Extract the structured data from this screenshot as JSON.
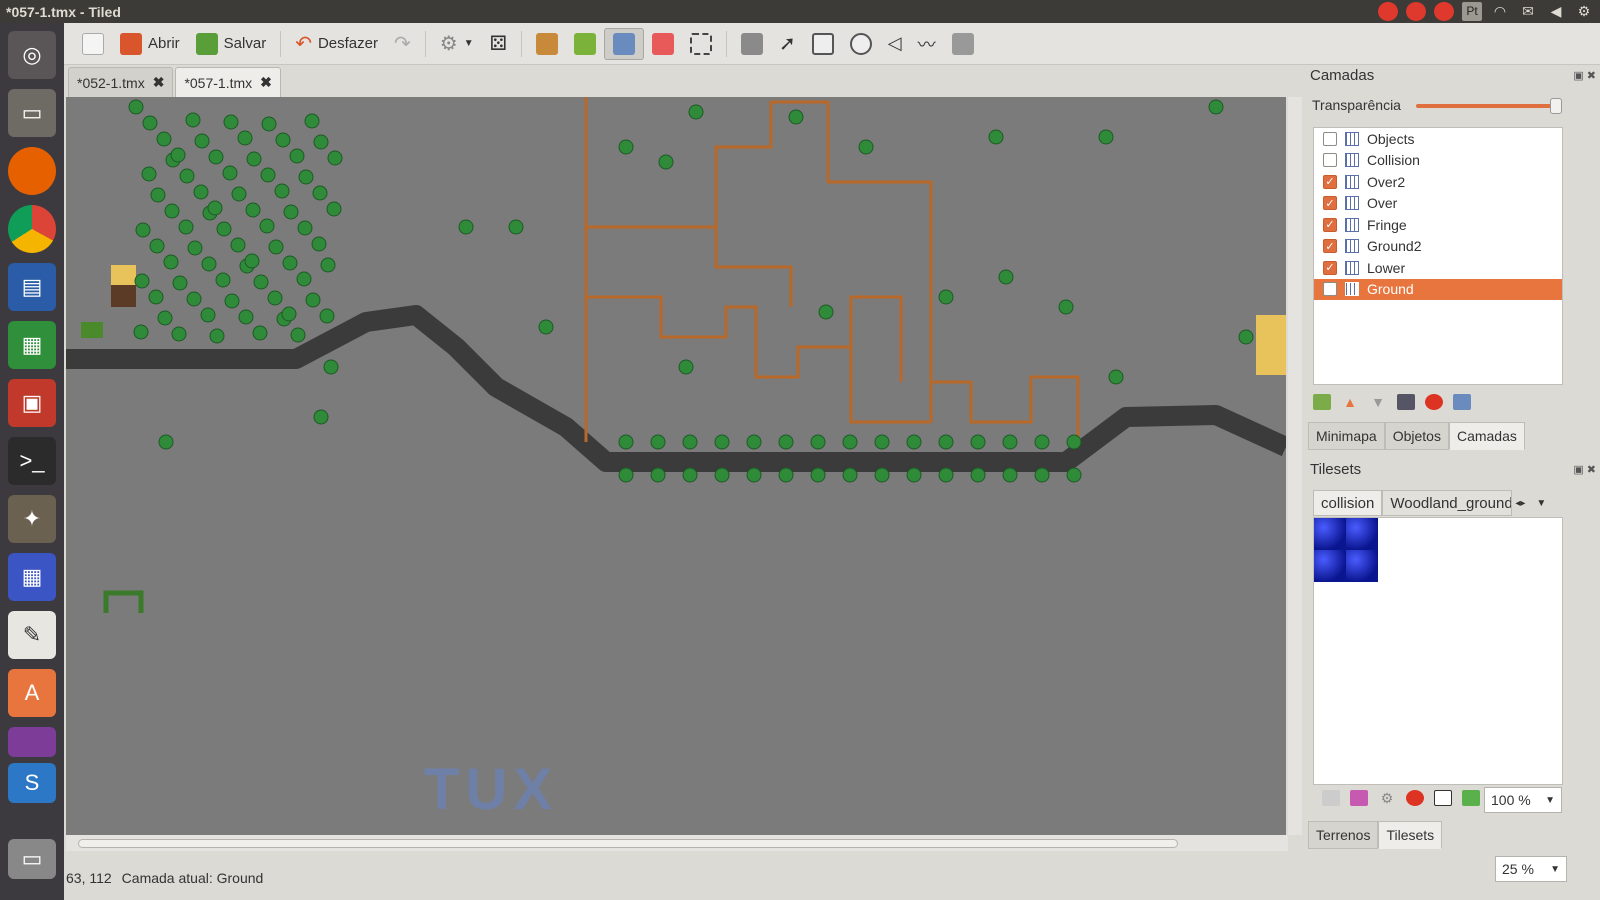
{
  "window": {
    "title": "*057-1.tmx - Tiled"
  },
  "tray": {
    "language": "Pt"
  },
  "toolbar": {
    "open_label": "Abrir",
    "save_label": "Salvar",
    "undo_label": "Desfazer"
  },
  "tabs": [
    {
      "label": "*052-1.tmx"
    },
    {
      "label": "*057-1.tmx"
    }
  ],
  "map": {
    "watermark": "TUX"
  },
  "status": {
    "coords": "63, 112",
    "current_layer": "Camada atual: Ground",
    "zoom": "25 %"
  },
  "layers_panel": {
    "title": "Camadas",
    "transparency_label": "Transparência",
    "transparency_value": 1.0,
    "items": [
      {
        "name": "Objects",
        "checked": false
      },
      {
        "name": "Collision",
        "checked": false
      },
      {
        "name": "Over2",
        "checked": true
      },
      {
        "name": "Over",
        "checked": true
      },
      {
        "name": "Fringe",
        "checked": true
      },
      {
        "name": "Ground2",
        "checked": true
      },
      {
        "name": "Lower",
        "checked": true
      },
      {
        "name": "Ground",
        "checked": false
      }
    ],
    "tabs": [
      "Minimapa",
      "Objetos",
      "Camadas"
    ]
  },
  "tilesets_panel": {
    "title": "Tilesets",
    "tabs": [
      "collision",
      "Woodland_ground"
    ],
    "zoom": "100 %",
    "bottom_tabs": [
      "Terrenos",
      "Tilesets"
    ]
  },
  "colors": {
    "accent": "#e8743e",
    "map_bg": "#7b7b7b",
    "path": "#b8692a"
  }
}
